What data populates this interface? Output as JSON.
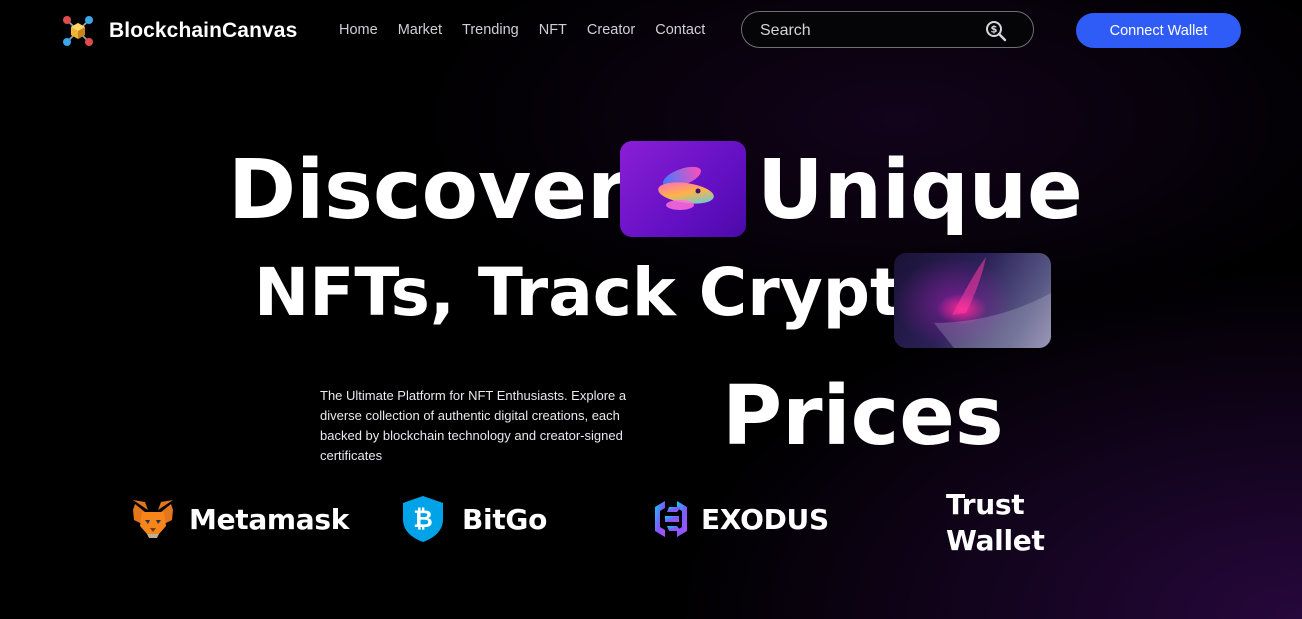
{
  "brand": {
    "name": "BlockchainCanvas",
    "logo_icon": "cube-network-icon"
  },
  "nav": {
    "links": [
      {
        "label": "Home"
      },
      {
        "label": "Market"
      },
      {
        "label": "Trending"
      },
      {
        "label": "NFT"
      },
      {
        "label": "Creator"
      },
      {
        "label": "Contact"
      }
    ]
  },
  "search": {
    "placeholder": "Search",
    "icon": "search-dollar-icon"
  },
  "connect_button": {
    "label": "Connect Wallet",
    "color": "#2f5cf7"
  },
  "hero": {
    "line1_word1": "Discover",
    "line1_word2": "Unique",
    "line2": "NFTs, Track Crypto",
    "line3": "Prices",
    "tagline": "The Ultimate Platform for NFT Enthusiasts. Explore a diverse collection of authentic digital creations, each backed by blockchain technology and creator-signed certificates"
  },
  "wallets": [
    {
      "label": "Metamask",
      "icon": "metamask-fox-icon"
    },
    {
      "label": "BitGo",
      "icon": "bitgo-shield-icon"
    },
    {
      "label": "EXODUS",
      "icon": "exodus-logo-icon"
    },
    {
      "label": "Trust Wallet",
      "icon": ""
    }
  ],
  "colors": {
    "background": "#000000",
    "accent": "#2f5cf7",
    "purple": "#7a16d0"
  }
}
